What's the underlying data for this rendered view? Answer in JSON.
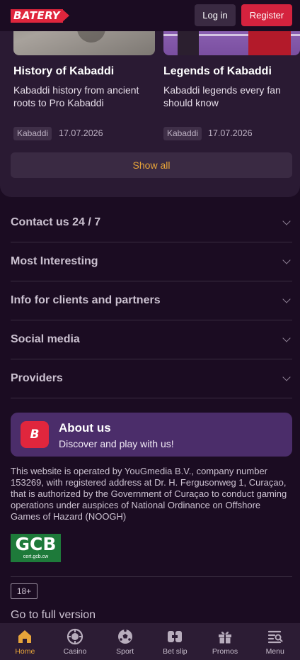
{
  "header": {
    "logo_text": "BATERY",
    "login_label": "Log in",
    "register_label": "Register"
  },
  "articles": [
    {
      "title": "History of Kabaddi",
      "description": "Kabaddi history from ancient roots to Pro Kabaddi",
      "tag": "Kabaddi",
      "date": "17.07.2026"
    },
    {
      "title": "Legends of Kabaddi",
      "description": "Kabaddi legends every fan should know",
      "tag": "Kabaddi",
      "date": "17.07.2026"
    }
  ],
  "show_all_label": "Show all",
  "accordion": [
    {
      "label": "Contact us 24 / 7"
    },
    {
      "label": "Most Interesting"
    },
    {
      "label": "Info for clients and partners"
    },
    {
      "label": "Social media"
    },
    {
      "label": "Providers"
    }
  ],
  "about": {
    "logo_text": "B",
    "title": "About us",
    "subtitle": "Discover and play with us!"
  },
  "legal_text": "This website is operated by YouGmedia B.V., company number 153269, with registered address at Dr. H. Fergusonweg 1, Curaçao, that is authorized by the Government of Curaçao to conduct gaming operations under auspices of National Ordinance on Offshore Games of Hazard (NOOGH)",
  "gcb": {
    "big": "GCB",
    "small": "cert.gcb.cw"
  },
  "age_badge": "18+",
  "full_version_label": "Go to full version",
  "nav": [
    {
      "label": "Home",
      "icon": "home-icon",
      "active": true
    },
    {
      "label": "Casino",
      "icon": "casino-chip-icon",
      "active": false
    },
    {
      "label": "Sport",
      "icon": "soccer-ball-icon",
      "active": false
    },
    {
      "label": "Bet slip",
      "icon": "ticket-icon",
      "active": false
    },
    {
      "label": "Promos",
      "icon": "gift-icon",
      "active": false
    },
    {
      "label": "Menu",
      "icon": "menu-search-icon",
      "active": false
    }
  ],
  "colors": {
    "background": "#1b0c22",
    "panel": "#2a1a33",
    "brand_red": "#e0263d",
    "accent_orange": "#e7a43a",
    "about_purple": "#4b2d6a"
  }
}
